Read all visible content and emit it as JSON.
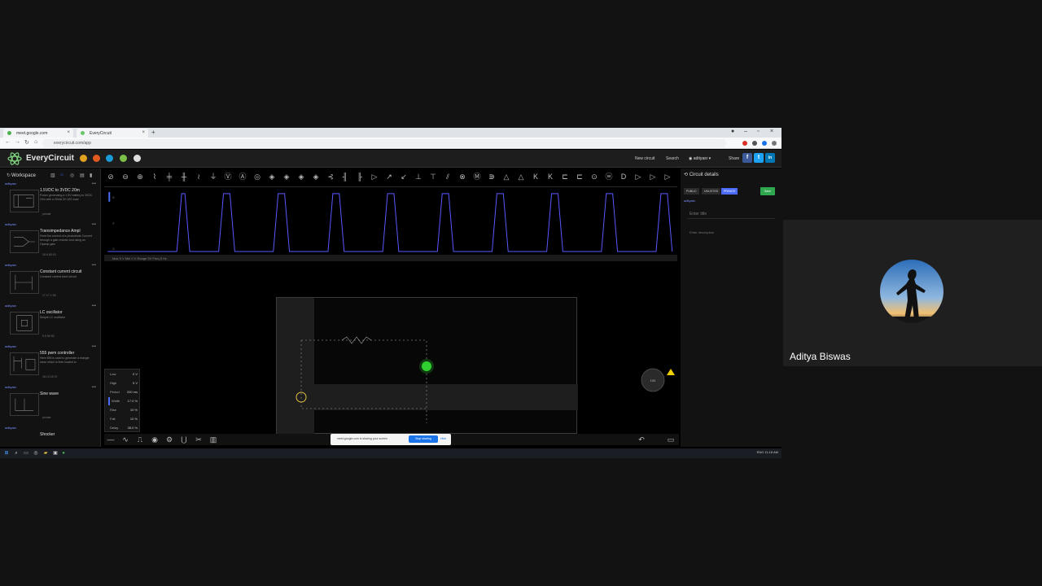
{
  "browser": {
    "tabs": [
      "meet.google.com",
      "EveryCircuit"
    ],
    "url": "everycircuit.com/app"
  },
  "app": {
    "brand": "EveryCircuit",
    "header_links": [
      "New circuit",
      "Search"
    ],
    "user": "adityasr",
    "share_label": "Share",
    "social": [
      "f",
      "t",
      "in"
    ]
  },
  "sidebar": {
    "workspace_label": "Workspace",
    "items": [
      {
        "user": "adityasr",
        "title": "1.5VDC to 3VDC 20m",
        "desc": "Power generating a 1.5V battery to 3VDC 20m with a 20mA 3V LED load",
        "stats": "private"
      },
      {
        "user": "adityasr",
        "title": "Transimpedance Ampl",
        "desc": "Feed the current of a photodiode Convert through a gain resistor and using an Opamp gain",
        "stats": "18  6  65 43"
      },
      {
        "user": "adityasr",
        "title": "Constant current circuit",
        "desc": "Constant current short circuit",
        "stats": "17  17  1 56"
      },
      {
        "user": "adityasr",
        "title": "LC oscillator",
        "desc": "Simple LC oscillator",
        "stats": "5  5  59 53"
      },
      {
        "user": "adityasr",
        "title": "555 pwm controller",
        "desc": "Here 555 is used to generate a triangle wave which is then loaded to",
        "stats": "18  13  18 37"
      },
      {
        "user": "adityasr",
        "title": "Sine wave",
        "desc": "",
        "stats": "private"
      },
      {
        "user": "adityasr",
        "title": "Shocker",
        "desc": "",
        "stats": ""
      }
    ]
  },
  "scope": {
    "info": "Max 5 V  Min 0 V  Range 5V  Freq 5 Hz"
  },
  "signal": {
    "rows": [
      {
        "k": "Low",
        "v": "0 V"
      },
      {
        "k": "High",
        "v": "5 V"
      },
      {
        "k": "Period",
        "v": "200 ms"
      },
      {
        "k": "Width",
        "v": "17.0 %"
      },
      {
        "k": "Rise",
        "v": "10 %"
      },
      {
        "k": "Fall",
        "v": "10 %"
      },
      {
        "k": "Delay",
        "v": "38.0 %"
      }
    ]
  },
  "share_notice": {
    "text": "meet.google.com is sharing your screen",
    "stop": "Stop sharing",
    "hide": "Hide"
  },
  "right_panel": {
    "title": "Circuit details",
    "visibility": [
      "PUBLIC",
      "UNLISTED",
      "PRIVATE"
    ],
    "save": "Save",
    "user": "adityasr",
    "title_placeholder": "Enter title",
    "desc_placeholder": "Enter description"
  },
  "taskbar": {
    "tray": "ENG  11:18 AM"
  },
  "meeting": {
    "participant": "Aditya Biswas"
  },
  "colors": {
    "accent": "#4a6cf7",
    "led": "#2fd12f",
    "save": "#2fa84f"
  }
}
